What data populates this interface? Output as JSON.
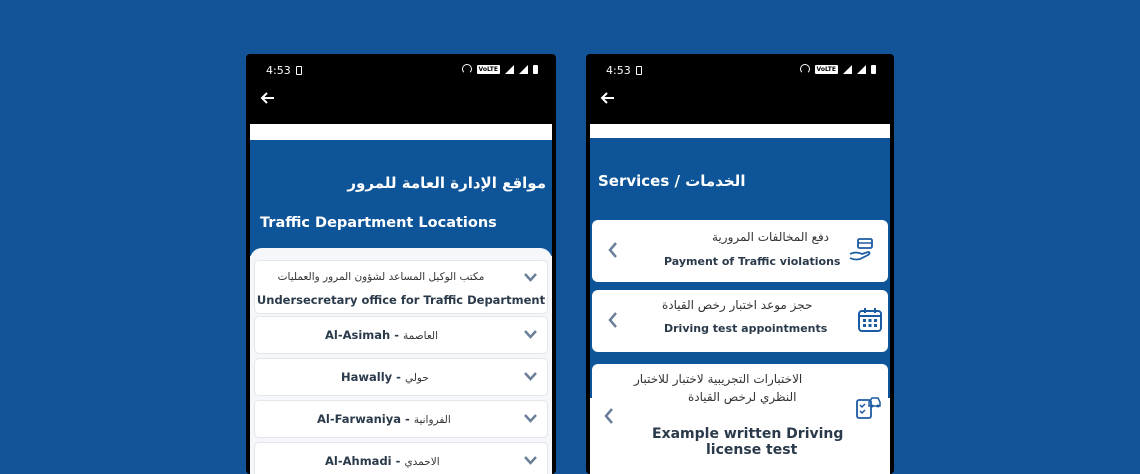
{
  "status_bar": {
    "time": "4:53",
    "network": "VoLTE"
  },
  "left_screen": {
    "title_ar": "مواقع الإدارة العامة للمرور",
    "title_en": "Traffic Department Locations",
    "items": [
      {
        "ar": "مكتب الوكيل المساعد لشؤون المرور والعمليات",
        "en": "Undersecretary office for Traffic Department"
      },
      {
        "label": "Al-Asimah",
        "ar": "العاصمة"
      },
      {
        "label": "Hawally",
        "ar": "حولي"
      },
      {
        "label": "Al-Farwaniya",
        "ar": "الفروانية"
      },
      {
        "label": "Al-Ahmadi",
        "ar": "الاحمدي"
      }
    ],
    "separator": "-"
  },
  "right_screen": {
    "title": "Services / الخدمات",
    "services": [
      {
        "ar": "دفع المخالفات المرورية",
        "en": "Payment of Traffic violations",
        "icon": "hand-card-icon"
      },
      {
        "ar": "حجز موعد اختبار رخص القيادة",
        "en": "Driving test appointments",
        "icon": "calendar-icon"
      },
      {
        "ar_line1": "الاختبارات التجريبية لاختبار للاختبار",
        "ar_line2": "النظري لرخص القيادة",
        "en_line1": "Example written Driving",
        "en_line2": "license test",
        "icon": "checklist-car-icon"
      }
    ]
  },
  "colors": {
    "background": "#135398",
    "header": "#0d5498",
    "chevron": "#6b7f99"
  }
}
